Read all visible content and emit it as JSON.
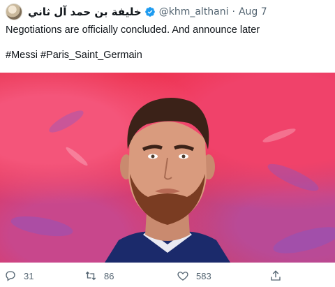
{
  "tweet": {
    "author": {
      "display_name": "خليفة بن حمد آل ثاني",
      "handle": "@khm_althani",
      "verified_icon": "verified-badge-icon",
      "verified_color": "#1d9bf0"
    },
    "separator": "·",
    "date": "Aug 7",
    "text_line1": "Negotiations are officially concluded. And announce later",
    "text_line2": "#Messi #Paris_Saint_Germain",
    "media": {
      "description_icon": "player-portrait-image",
      "background_color": "#e8334f"
    },
    "actions": {
      "reply_count": "31",
      "retweet_count": "86",
      "like_count": "583",
      "reply_icon": "reply-icon",
      "retweet_icon": "retweet-icon",
      "like_icon": "heart-icon",
      "share_icon": "share-icon"
    }
  }
}
